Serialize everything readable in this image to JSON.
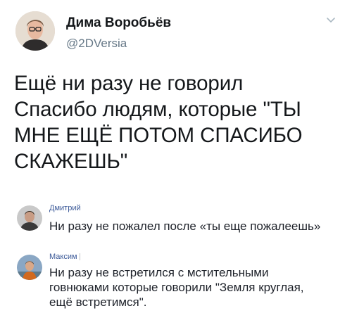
{
  "tweet": {
    "author_name": "Дима Воробьёв",
    "author_handle": "@2DVersia",
    "text": "Ещё ни разу не говорил\nСпасибо людям, которые \"ТЫ\nМНЕ ЕЩЁ ПОТОМ СПАСИБО\nСКАЖЕШЬ\"",
    "menu_icon": "chevron-down-icon"
  },
  "comments": [
    {
      "author": "Дмитрий",
      "text": "Ни разу не пожалел после «ты еще пожалеешь»"
    },
    {
      "author": "Максим",
      "text": "Ни разу не встретился с  мстительными\nговнюками которые говорили \"Земля круглая,\nещё встретимся\"."
    }
  ],
  "colors": {
    "name": "#14171a",
    "handle": "#657786",
    "comment_author": "#3b5998",
    "comment_text": "#1d2129"
  }
}
